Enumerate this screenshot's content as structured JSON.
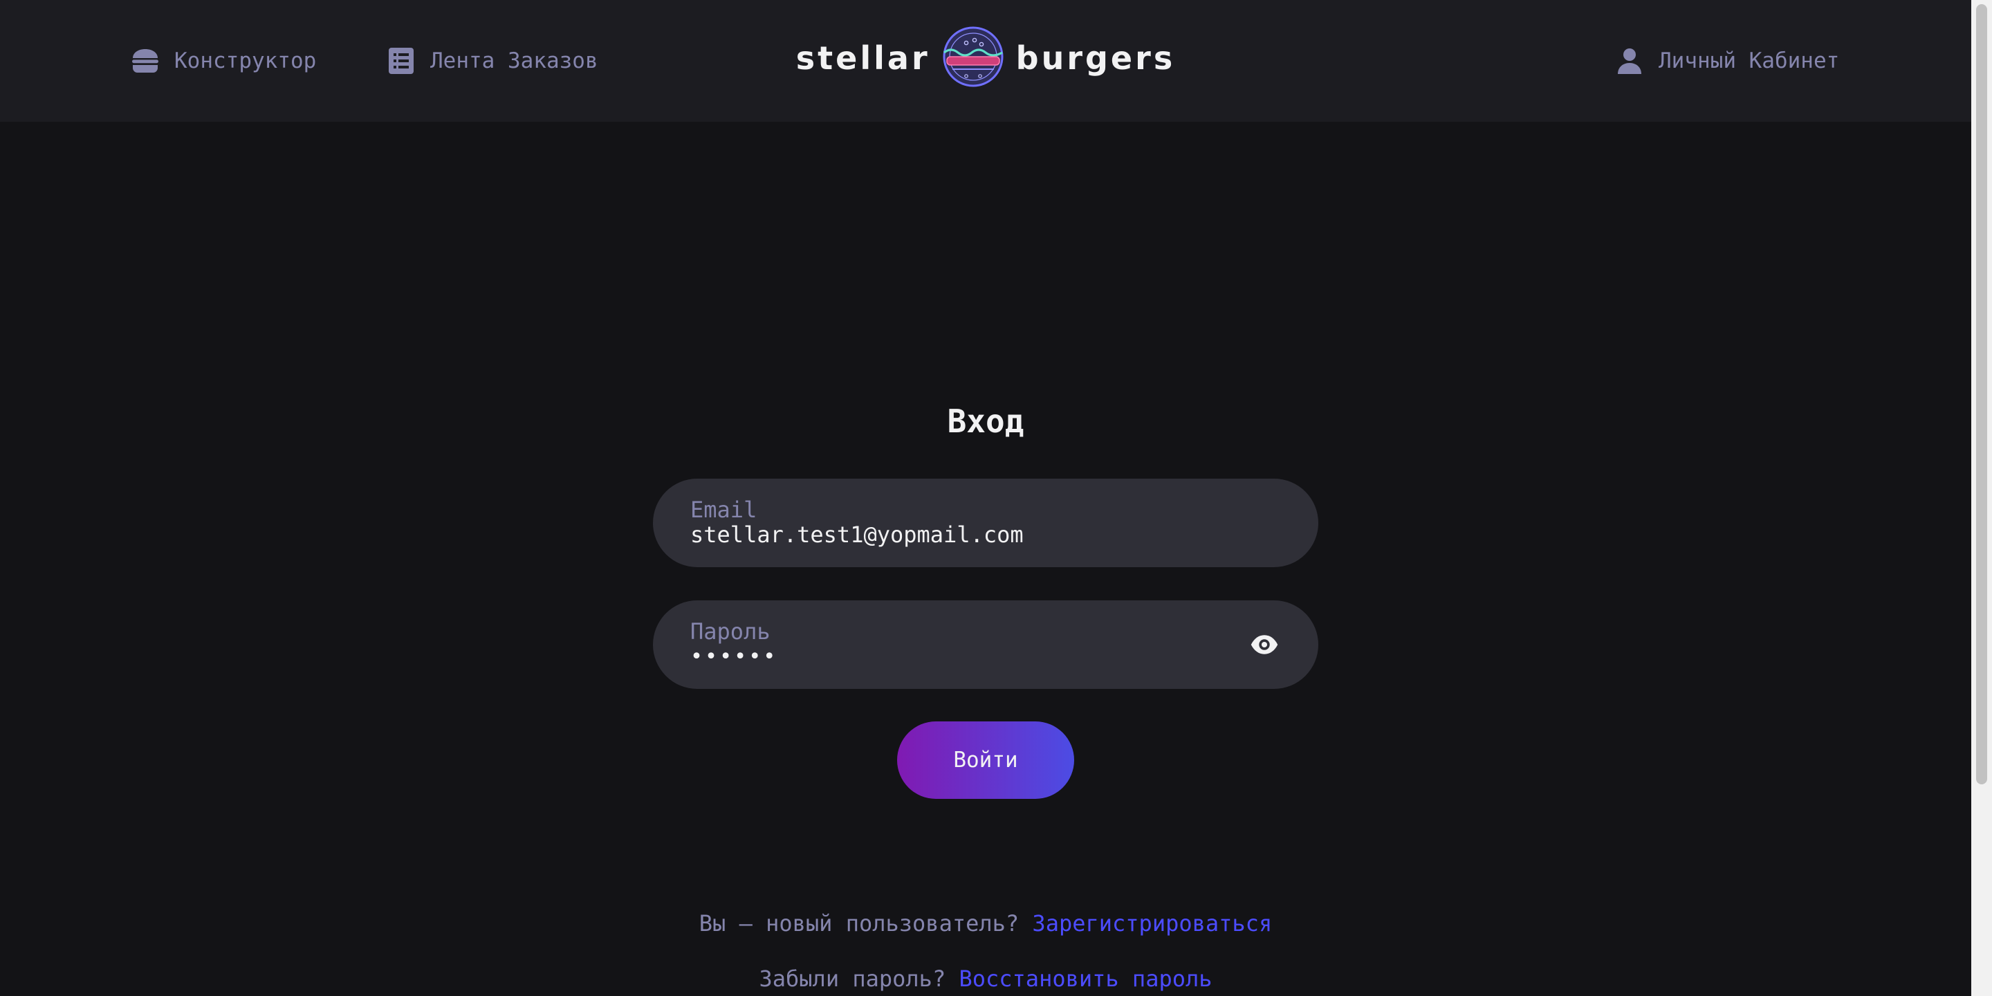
{
  "header": {
    "nav": [
      {
        "label": "Конструктор",
        "icon": "burger-icon"
      },
      {
        "label": "Лента Заказов",
        "icon": "list-icon"
      }
    ],
    "logo": {
      "left_word": "stellar",
      "right_word": "burgers"
    },
    "account": {
      "label": "Личный Кабинет",
      "icon": "profile-icon"
    }
  },
  "login": {
    "title": "Вход",
    "email": {
      "label": "Email",
      "value": "stellar.test1@yopmail.com"
    },
    "password": {
      "label": "Пароль",
      "value": "••••••",
      "toggle_icon": "eye-icon"
    },
    "submit_label": "Войти",
    "register": {
      "prompt": "Вы — новый пользователь?",
      "link": "Зарегистрироваться"
    },
    "forgot": {
      "prompt": "Забыли пароль?",
      "link": "Восстановить пароль"
    }
  },
  "colors": {
    "background": "#131316",
    "header": "#1c1c21",
    "input": "#2f2f37",
    "muted_text": "#8585ad",
    "link": "#4c4cff",
    "gradient_start": "#801ab2",
    "gradient_end": "#4c4ce4"
  }
}
